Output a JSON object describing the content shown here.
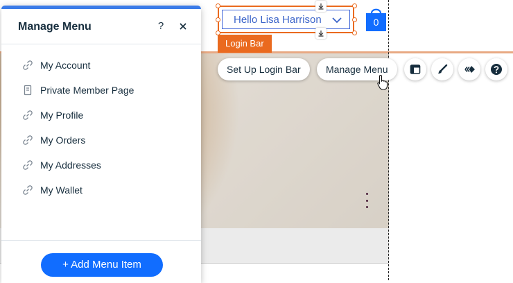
{
  "panel": {
    "title": "Manage Menu",
    "help_symbol": "?",
    "items": [
      {
        "label": "My Account",
        "icon": "link-icon"
      },
      {
        "label": "Private Member Page",
        "icon": "page-icon"
      },
      {
        "label": "My Profile",
        "icon": "link-icon"
      },
      {
        "label": "My Orders",
        "icon": "link-icon"
      },
      {
        "label": "My Addresses",
        "icon": "link-icon"
      },
      {
        "label": "My Wallet",
        "icon": "link-icon"
      }
    ],
    "add_button_label": "+ Add Menu Item"
  },
  "login_bar": {
    "greeting": "Hello Lisa Harrison",
    "tag_label": "Login Bar"
  },
  "cart": {
    "count": "0"
  },
  "action_bar": {
    "setup_label": "Set Up Login Bar",
    "manage_label": "Manage Menu",
    "icons": [
      "layout-icon",
      "design-brush-icon",
      "animation-icon",
      "help-icon"
    ]
  },
  "colors": {
    "accent_blue": "#116dff",
    "selection_orange": "#ea6a1f",
    "cart_blue": "#116dff"
  }
}
